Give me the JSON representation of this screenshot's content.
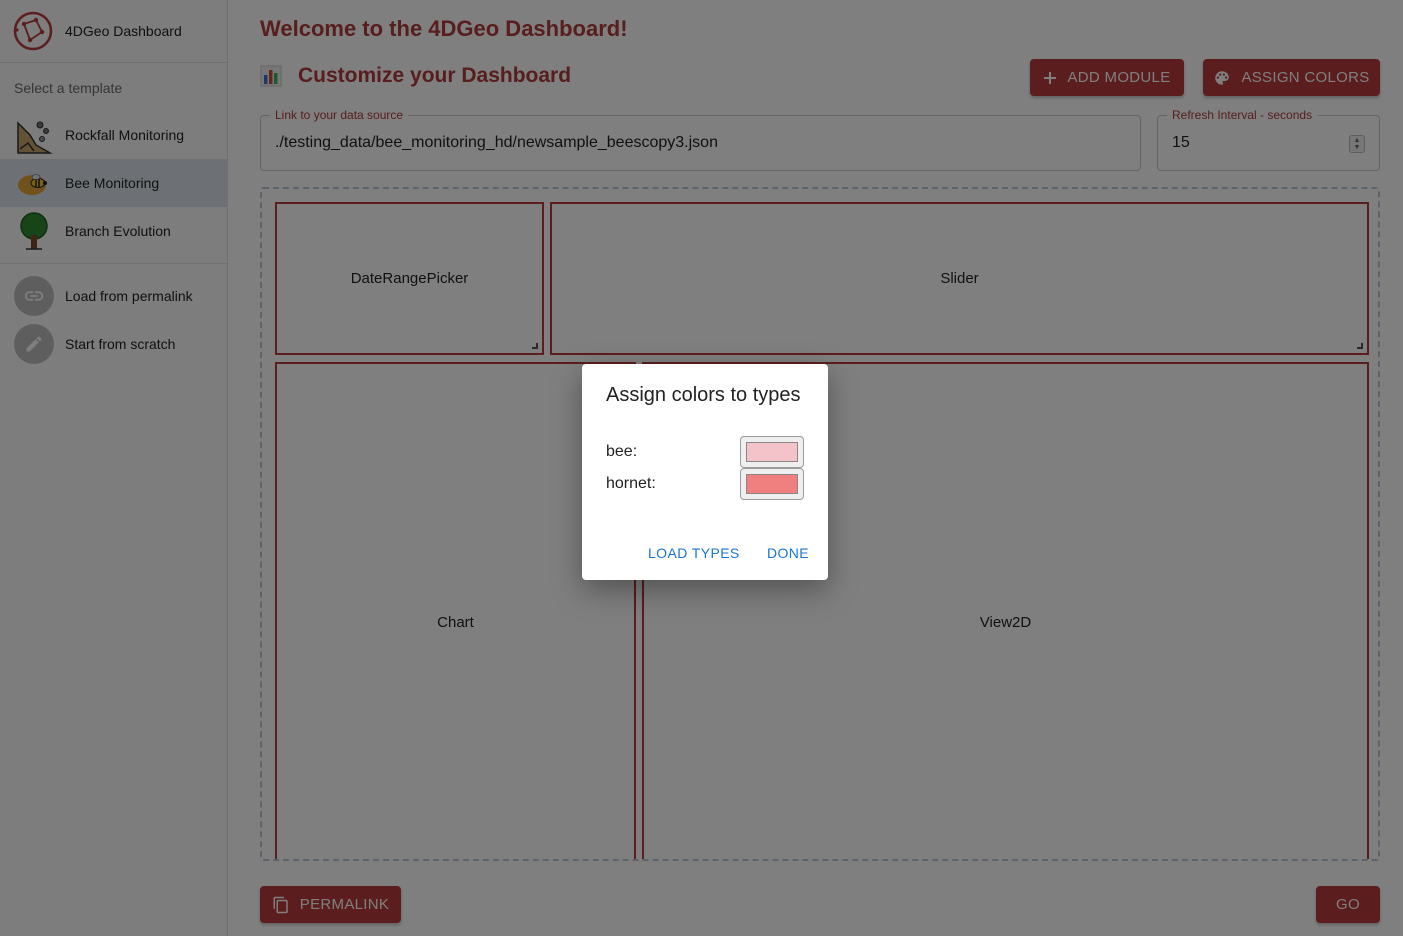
{
  "sidebar": {
    "app_name": "4DGeo Dashboard",
    "section_label": "Select a template",
    "templates": [
      {
        "label": "Rockfall Monitoring",
        "icon": "rockfall-icon"
      },
      {
        "label": "Bee Monitoring",
        "icon": "bee-icon",
        "selected": true
      },
      {
        "label": "Branch Evolution",
        "icon": "tree-icon"
      }
    ],
    "actions": [
      {
        "label": "Load from permalink",
        "icon": "link-icon"
      },
      {
        "label": "Start from scratch",
        "icon": "pencil-icon"
      }
    ]
  },
  "main": {
    "welcome": "Welcome to the 4DGeo Dashboard!",
    "customize_title": "Customize your Dashboard",
    "add_module_label": "ADD MODULE",
    "assign_colors_label": "ASSIGN COLORS",
    "data_source": {
      "label": "Link to your data source",
      "value": "./testing_data/bee_monitoring_hd/newsample_beescopy3.json"
    },
    "refresh": {
      "label": "Refresh Interval - seconds",
      "value": "15"
    },
    "modules": [
      "DateRangePicker",
      "Slider",
      "Chart",
      "View2D"
    ],
    "permalink_label": "PERMALINK",
    "go_label": "GO"
  },
  "dialog": {
    "title": "Assign colors to types",
    "types": [
      {
        "name": "bee:",
        "color": "#f4c2c9"
      },
      {
        "name": "hornet:",
        "color": "#f08080"
      }
    ],
    "load_types_label": "LOAD TYPES",
    "done_label": "DONE"
  },
  "colors": {
    "accent": "#b63a3a",
    "link_blue": "#1976d2"
  }
}
